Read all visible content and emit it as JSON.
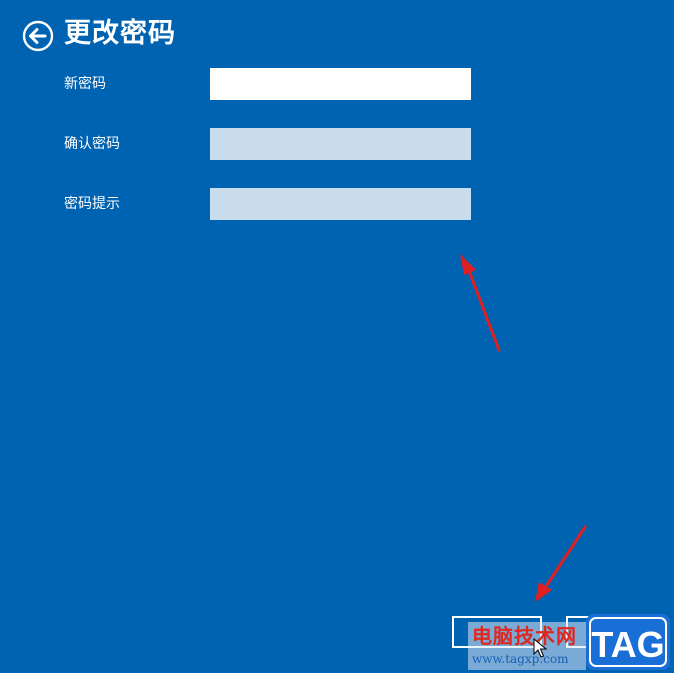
{
  "header": {
    "title": "更改密码",
    "back_icon": "back-arrow-circle-icon"
  },
  "form": {
    "fields": [
      {
        "label": "新密码",
        "value": "",
        "state": "active"
      },
      {
        "label": "确认密码",
        "value": "",
        "state": "disabled"
      },
      {
        "label": "密码提示",
        "value": "",
        "state": "disabled"
      }
    ]
  },
  "footer": {
    "next_label": "",
    "cancel_label": ""
  },
  "watermark": {
    "site_name": "电脑技术网",
    "url": "www.tagxp.com",
    "logo_text": "TAG",
    "logo_color": "#1a6fd6",
    "site_name_color": "#e0261e"
  },
  "annotations": {
    "arrow_color": "#e02020"
  },
  "colors": {
    "background": "#0063b1",
    "input_active": "#ffffff",
    "input_disabled": "#c9dcec"
  }
}
